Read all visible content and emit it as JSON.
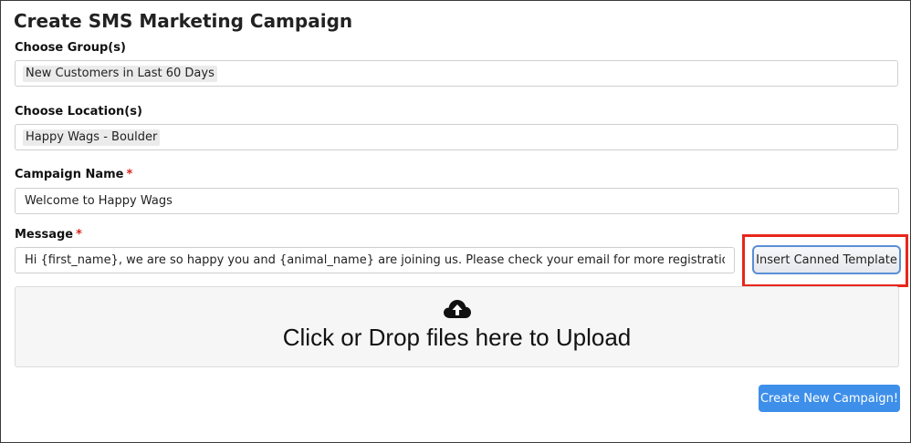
{
  "page": {
    "title": "Create SMS Marketing Campaign"
  },
  "groups": {
    "label": "Choose Group(s)",
    "selected": "New Customers in Last 60 Days"
  },
  "locations": {
    "label": "Choose Location(s)",
    "selected": "Happy Wags - Boulder"
  },
  "campaign_name": {
    "label": "Campaign Name",
    "required_mark": "*",
    "value": "Welcome to Happy Wags"
  },
  "message": {
    "label": "Message",
    "required_mark": "*",
    "value": "Hi {first_name}, we are so happy you and {animal_name} are joining us. Please check your email for more registration details. Looking fo",
    "template_button_label": "Insert Canned Template"
  },
  "upload": {
    "icon": "cloud-upload-icon",
    "text": "Click or Drop files here to Upload"
  },
  "actions": {
    "submit_label": "Create New Campaign!"
  },
  "colors": {
    "accent": "#3d8fea",
    "required": "#d9251c",
    "highlight": "#e8261b",
    "border": "#cfcfcf",
    "upload_bg": "#f6f6f6"
  }
}
